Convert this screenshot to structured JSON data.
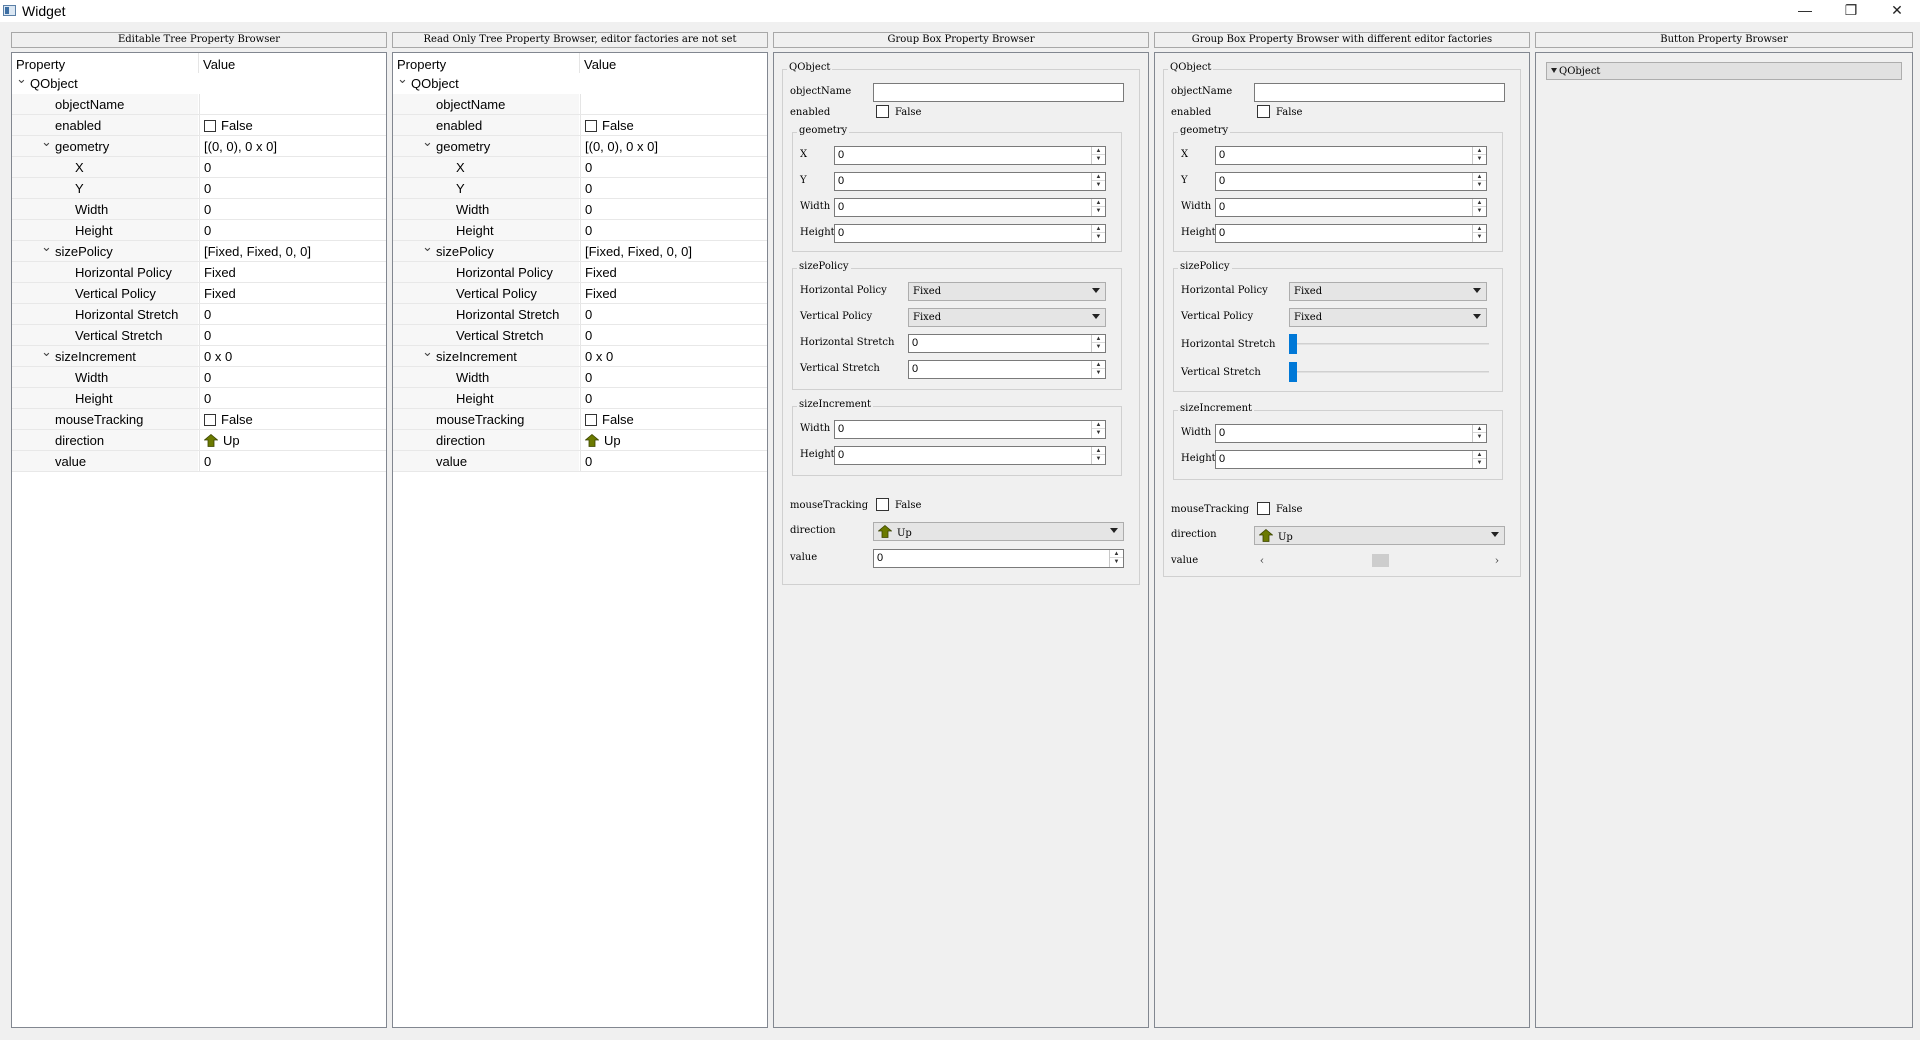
{
  "window": {
    "title": "Widget",
    "minimize_glyph": "—",
    "maximize_glyph": "❐",
    "close_glyph": "✕"
  },
  "panels": {
    "editable_tree": {
      "title": "Editable Tree Property Browser"
    },
    "readonly_tree": {
      "title": "Read Only Tree Property Browser, editor factories are not set"
    },
    "groupbox": {
      "title": "Group Box Property Browser"
    },
    "groupbox_alt": {
      "title": "Group Box Property Browser with different editor factories"
    },
    "button": {
      "title": "Button Property Browser",
      "item": "QObject"
    }
  },
  "tree": {
    "header_property": "Property",
    "header_value": "Value",
    "rows": [
      {
        "label": "QObject",
        "value": ""
      },
      {
        "label": "objectName",
        "value": ""
      },
      {
        "label": "enabled",
        "value": "False"
      },
      {
        "label": "geometry",
        "value": "[(0, 0), 0 x 0]"
      },
      {
        "label": "X",
        "value": "0"
      },
      {
        "label": "Y",
        "value": "0"
      },
      {
        "label": "Width",
        "value": "0"
      },
      {
        "label": "Height",
        "value": "0"
      },
      {
        "label": "sizePolicy",
        "value": "[Fixed, Fixed, 0, 0]"
      },
      {
        "label": "Horizontal Policy",
        "value": "Fixed"
      },
      {
        "label": "Vertical Policy",
        "value": "Fixed"
      },
      {
        "label": "Horizontal Stretch",
        "value": "0"
      },
      {
        "label": "Vertical Stretch",
        "value": "0"
      },
      {
        "label": "sizeIncrement",
        "value": "0 x 0"
      },
      {
        "label": "Width",
        "value": "0"
      },
      {
        "label": "Height",
        "value": "0"
      },
      {
        "label": "mouseTracking",
        "value": "False"
      },
      {
        "label": "direction",
        "value": "Up"
      },
      {
        "label": "value",
        "value": "0"
      }
    ]
  },
  "gbox": {
    "qobject": "QObject",
    "objectName": "objectName",
    "objectName_value": "",
    "enabled": "enabled",
    "enabled_value": "False",
    "geometry": "geometry",
    "x": "X",
    "y": "Y",
    "width": "Width",
    "height": "Height",
    "zero": "0",
    "sizePolicy": "sizePolicy",
    "hpolicy": "Horizontal Policy",
    "vpolicy": "Vertical Policy",
    "hstretch": "Horizontal Stretch",
    "vstretch": "Vertical Stretch",
    "fixed": "Fixed",
    "sizeIncrement": "sizeIncrement",
    "mouseTracking": "mouseTracking",
    "mouseTracking_value": "False",
    "direction": "direction",
    "direction_value": "Up",
    "value": "value",
    "value_value": "0"
  },
  "scroll": {
    "left": "‹",
    "right": "›"
  },
  "colors": {
    "arrow_fill": "#6b7a00",
    "arrow_stroke": "#3b4400",
    "slider": "#0078d7"
  }
}
